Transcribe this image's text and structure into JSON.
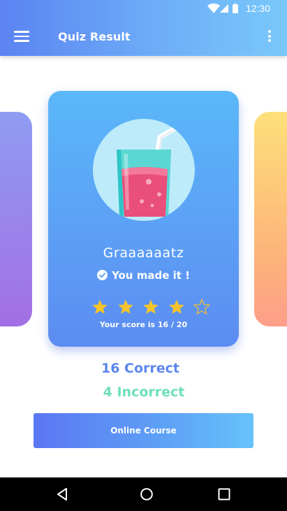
{
  "status_bar": {
    "time": "12:30",
    "icons": [
      "wifi-icon",
      "signal-icon",
      "battery-icon"
    ]
  },
  "app_bar": {
    "title": "Quiz Result",
    "left_icon": "menu-icon",
    "right_icon": "more-vert-icon"
  },
  "result_card": {
    "illustration": "juice-glass-icon",
    "heading": "Graaaaaatz",
    "message": "You made it !",
    "message_icon": "check-circle-icon",
    "stars_filled": 4,
    "stars_total": 5,
    "score_text": "Your score is 16 / 20"
  },
  "summary": {
    "correct": "16 Correct",
    "incorrect": "4 Incorrect"
  },
  "cta": {
    "label": "Online Course"
  },
  "nav_bar": {
    "icons": [
      "back-icon",
      "home-icon",
      "recents-icon"
    ]
  },
  "colors": {
    "primary": "#5b83f2",
    "accent": "#79c8fb",
    "correct": "#5c86ef",
    "incorrect": "#6fe0b8",
    "star": "#f5c32c"
  }
}
